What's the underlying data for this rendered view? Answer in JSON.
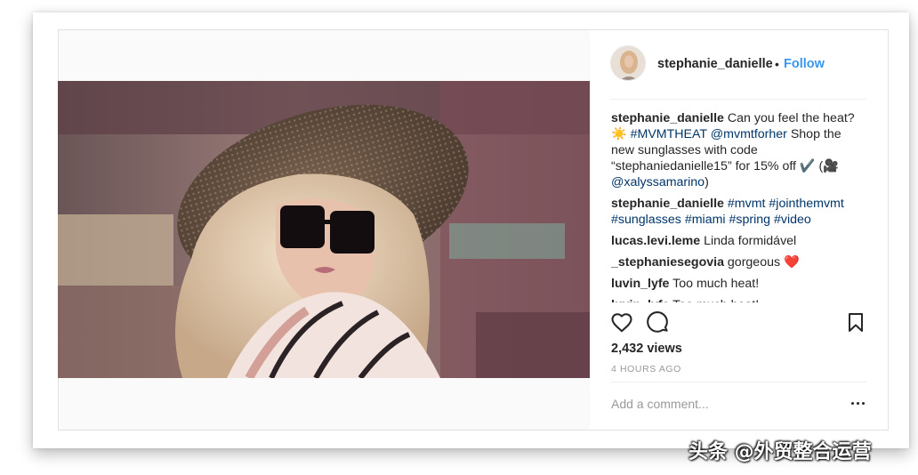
{
  "post": {
    "author": "stephanie_danielle",
    "separator": "•",
    "follow_label": "Follow",
    "views": "2,432 views",
    "time": "4 HOURS AGO",
    "add_comment_placeholder": "Add a comment..."
  },
  "comments": [
    {
      "user": "stephanie_danielle",
      "parts": [
        {
          "text": " Can you feel the heat? ☀️ ",
          "type": "text"
        },
        {
          "text": "#MVMTHEAT",
          "type": "tag"
        },
        {
          "text": " ",
          "type": "text"
        },
        {
          "text": "@mvmtforher",
          "type": "tag"
        },
        {
          "text": " Shop the new sunglasses with code “stephaniedanielle15” for 15% off ✔️ (🎥 ",
          "type": "text"
        },
        {
          "text": "@xalyssamarino",
          "type": "tag"
        },
        {
          "text": ")",
          "type": "text"
        }
      ]
    },
    {
      "user": "stephanie_danielle",
      "parts": [
        {
          "text": " ",
          "type": "text"
        },
        {
          "text": "#mvmt",
          "type": "tag"
        },
        {
          "text": " ",
          "type": "text"
        },
        {
          "text": "#jointhemvmt",
          "type": "tag"
        },
        {
          "text": " ",
          "type": "text"
        },
        {
          "text": "#sunglasses",
          "type": "tag"
        },
        {
          "text": " ",
          "type": "text"
        },
        {
          "text": "#miami",
          "type": "tag"
        },
        {
          "text": " ",
          "type": "text"
        },
        {
          "text": "#spring",
          "type": "tag"
        },
        {
          "text": " ",
          "type": "text"
        },
        {
          "text": "#video",
          "type": "tag"
        }
      ]
    },
    {
      "user": "lucas.levi.leme",
      "parts": [
        {
          "text": " Linda formidável",
          "type": "text"
        }
      ]
    },
    {
      "user": "_stephaniesegovia",
      "parts": [
        {
          "text": " gorgeous ",
          "type": "text"
        },
        {
          "text": "❤️",
          "type": "heart"
        }
      ]
    },
    {
      "user": "luvin_lyfe",
      "parts": [
        {
          "text": " Too much heat!",
          "type": "text"
        }
      ]
    },
    {
      "user": "luvin_lyfe",
      "parts": [
        {
          "text": " Too much heat!",
          "type": "text"
        }
      ]
    }
  ],
  "icons": {
    "like": "heart-outline-icon",
    "comment": "speech-bubble-icon",
    "save": "bookmark-icon",
    "more": "more-horizontal-icon"
  },
  "watermark": "头条 @外贸整合运营",
  "colors": {
    "link_blue": "#3897f0",
    "hashtag": "#003569",
    "text": "#262626",
    "muted": "#999999",
    "heart": "#e3162b"
  }
}
